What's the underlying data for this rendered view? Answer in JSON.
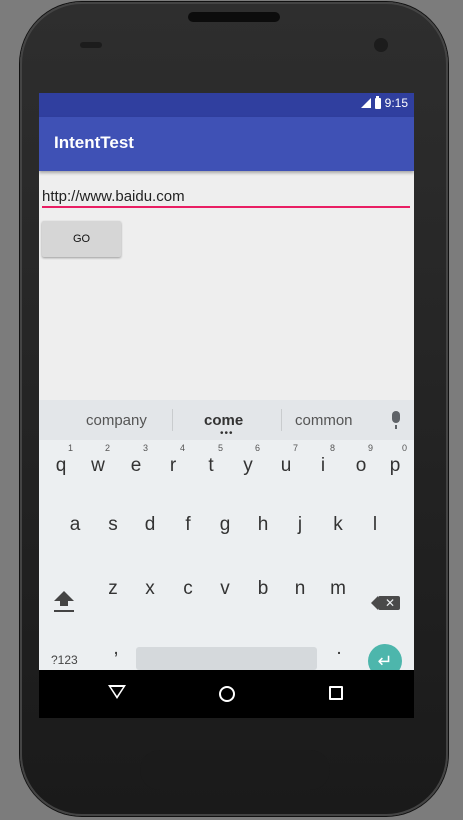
{
  "status_bar": {
    "time": "9:15",
    "signal_icon": "signal-icon",
    "battery_icon": "battery-icon"
  },
  "app_bar": {
    "title": "IntentTest",
    "color": "#3f51b5"
  },
  "url_field": {
    "value": "http://www.baidu.com",
    "underline_color": "#e91e63"
  },
  "go_button": {
    "label": "GO"
  },
  "keyboard": {
    "suggestions": [
      "company",
      "come",
      "common"
    ],
    "suggestion_dots": "•••",
    "row1": [
      {
        "key": "q",
        "num": "1"
      },
      {
        "key": "w",
        "num": "2"
      },
      {
        "key": "e",
        "num": "3"
      },
      {
        "key": "r",
        "num": "4"
      },
      {
        "key": "t",
        "num": "5"
      },
      {
        "key": "y",
        "num": "6"
      },
      {
        "key": "u",
        "num": "7"
      },
      {
        "key": "i",
        "num": "8"
      },
      {
        "key": "o",
        "num": "9"
      },
      {
        "key": "p",
        "num": "0"
      }
    ],
    "row2": [
      "a",
      "s",
      "d",
      "f",
      "g",
      "h",
      "j",
      "k",
      "l"
    ],
    "row3": [
      "z",
      "x",
      "c",
      "v",
      "b",
      "n",
      "m"
    ],
    "symbols_key": "?123",
    "comma_key": ",",
    "period_key": ".",
    "enter_glyph": "↵",
    "backspace_glyph": "✕",
    "accent_color": "#4db6ac"
  },
  "nav_bar": {
    "back_icon": "back-triangle-icon",
    "home_icon": "home-circle-icon",
    "recents_icon": "recents-square-icon"
  }
}
